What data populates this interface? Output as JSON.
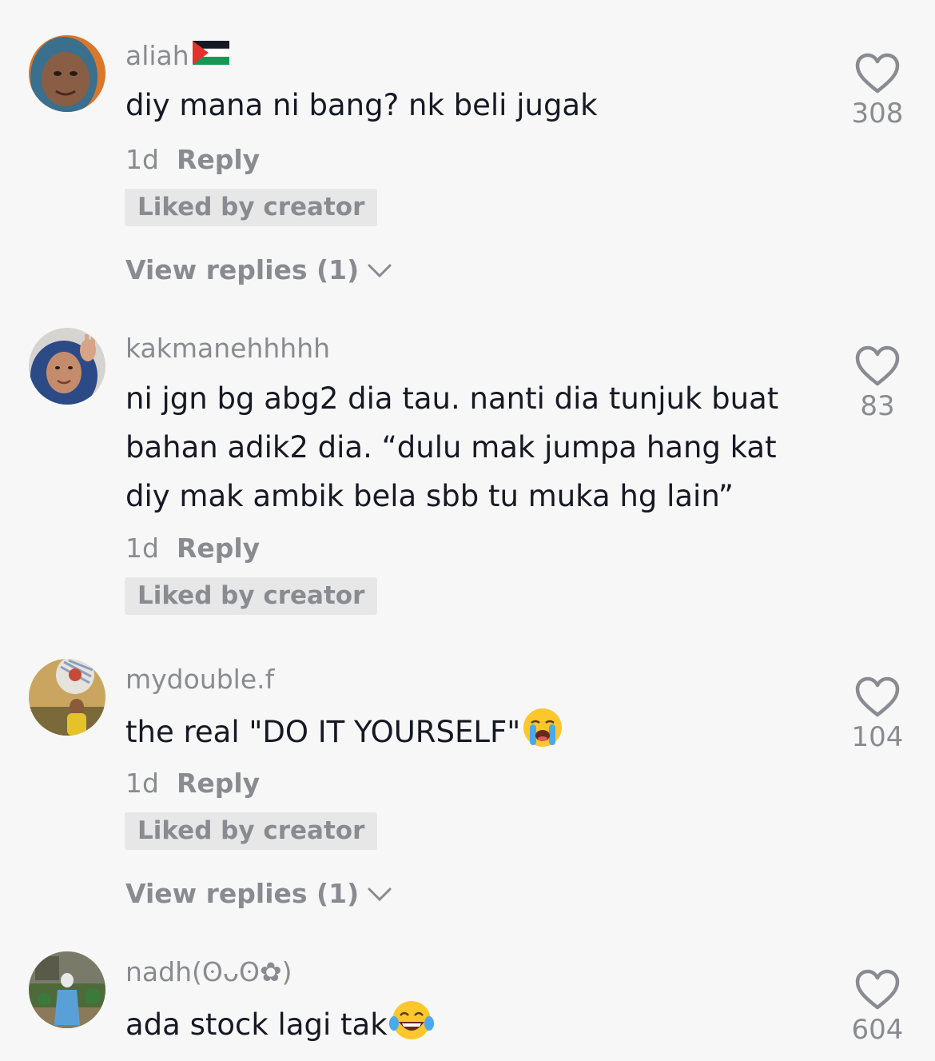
{
  "comments": [
    {
      "username": "aliah",
      "flag": "palestine-flag",
      "text": "diy mana ni bang? nk beli jugak",
      "time": "1d",
      "reply_label": "Reply",
      "liked_badge": "Liked by creator",
      "view_replies": "View replies (1)",
      "likes": "308"
    },
    {
      "username": "kakmanehhhhh",
      "text": "ni jgn bg abg2 dia tau. nanti dia tunjuk buat bahan adik2 dia. “dulu mak jumpa hang kat diy mak ambik bela sbb tu muka hg lain”",
      "time": "1d",
      "reply_label": "Reply",
      "liked_badge": "Liked by creator",
      "likes": "83"
    },
    {
      "username": "mydouble.f",
      "text": "the real \"DO IT YOURSELF\"",
      "emoji": "loudly-crying-face",
      "time": "1d",
      "reply_label": "Reply",
      "liked_badge": "Liked by creator",
      "view_replies": "View replies (1)",
      "likes": "104"
    },
    {
      "username": "nadh(ʘᴗʘ✿)",
      "text": "ada stock lagi tak",
      "emoji": "face-with-tears-of-joy",
      "likes": "604"
    }
  ],
  "colors": {
    "background": "#f7f7f7",
    "primary_text": "#161823",
    "secondary_text": "#8a8b91",
    "badge_bg": "#e7e7e8"
  }
}
